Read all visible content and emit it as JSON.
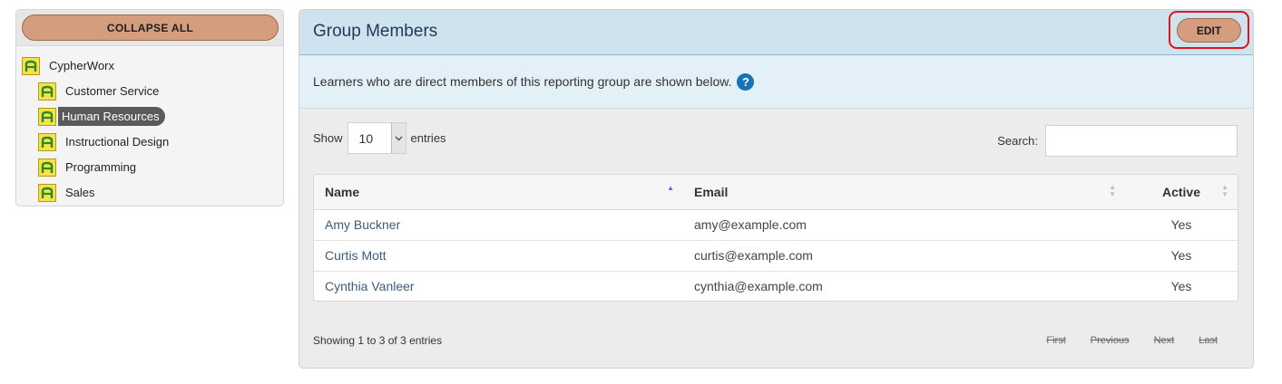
{
  "tree": {
    "collapse_label": "COLLAPSE ALL",
    "root": {
      "label": "CypherWorx"
    },
    "children": [
      {
        "label": "Customer Service"
      },
      {
        "label": "Human Resources",
        "selected": true
      },
      {
        "label": "Instructional Design"
      },
      {
        "label": "Programming"
      },
      {
        "label": "Sales"
      }
    ]
  },
  "header": {
    "title": "Group Members",
    "edit_label": "EDIT"
  },
  "info": {
    "text": "Learners who are direct members of this reporting group are shown below.",
    "help_glyph": "?"
  },
  "controls": {
    "show_label": "Show",
    "entries_value": "10",
    "entries_label": "entries",
    "search_label": "Search:",
    "search_value": ""
  },
  "table": {
    "columns": {
      "name": "Name",
      "email": "Email",
      "active": "Active"
    },
    "rows": [
      {
        "name": "Amy Buckner",
        "email": "amy@example.com",
        "active": "Yes"
      },
      {
        "name": "Curtis Mott",
        "email": "curtis@example.com",
        "active": "Yes"
      },
      {
        "name": "Cynthia Vanleer",
        "email": "cynthia@example.com",
        "active": "Yes"
      }
    ]
  },
  "footer": {
    "showing": "Showing 1 to 3 of 3 entries",
    "first": "First",
    "previous": "Previous",
    "next": "Next",
    "last": "Last"
  },
  "colors": {
    "button_fill": "#d49d7e",
    "header_bg": "#cfe3ee",
    "info_bg": "#e3f0f7",
    "selected_item": "#5a5a5a",
    "help_icon": "#1673b5",
    "edit_highlight": "#e0141e"
  }
}
